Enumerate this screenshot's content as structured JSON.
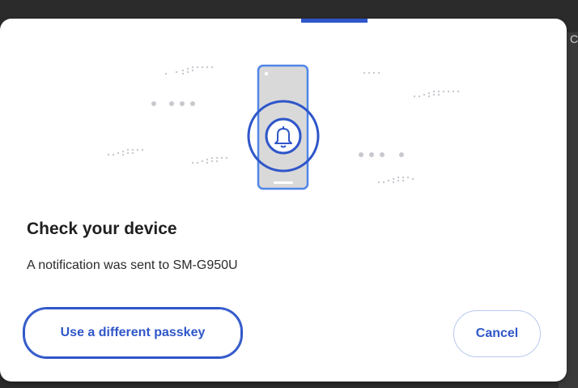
{
  "dialog": {
    "title": "Check your device",
    "message": "A notification was sent to SM-G950U",
    "buttons": {
      "use_different_passkey": "Use a different passkey",
      "cancel": "Cancel"
    }
  },
  "illustration": {
    "icons": [
      "phone-icon",
      "bell-icon"
    ]
  },
  "colors": {
    "accent": "#2f56c9",
    "phone_fill": "#d9d9d9",
    "phone_outline": "#4f86e8",
    "backdrop": "#2b2b2b"
  }
}
